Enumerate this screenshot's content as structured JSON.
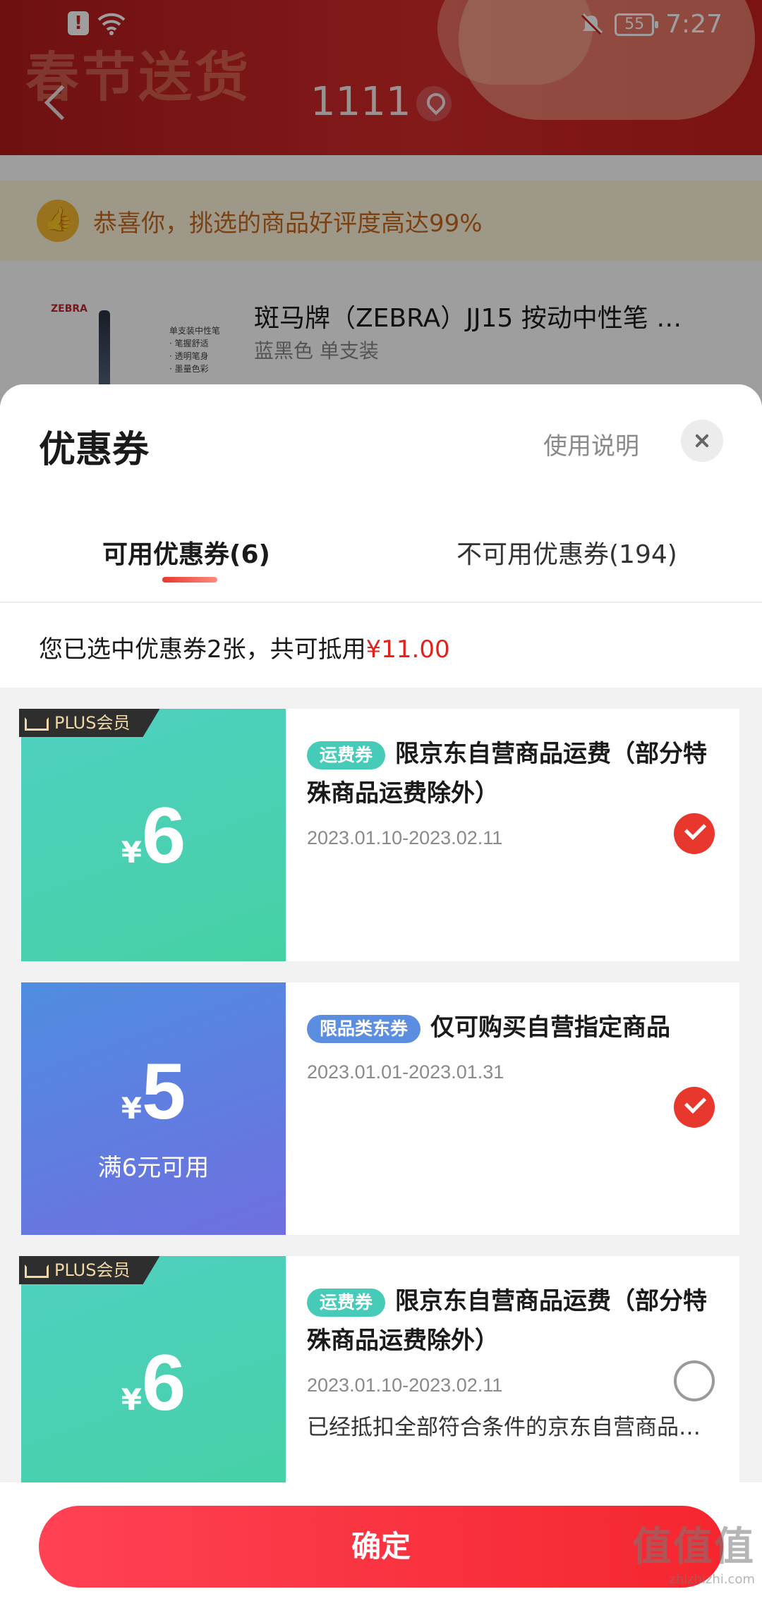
{
  "status_bar": {
    "battery": "55",
    "time": "7:27"
  },
  "background": {
    "festival_text": "春节送货",
    "address": "1111",
    "praise_text": "恭喜你，挑选的商品好评度高达99%",
    "product": {
      "brand": "ZEBRA",
      "image_caption": "单支装中性笔\n· 笔握舒适\n· 透明笔身\n· 墨量色彩",
      "title": "斑马牌（ZEBRA）JJ15 按动中性笔 …",
      "spec": "蓝黑色 单支装"
    }
  },
  "sheet": {
    "title": "优惠券",
    "help_label": "使用说明",
    "tabs": [
      {
        "label": "可用优惠券(6)",
        "active": true
      },
      {
        "label": "不可用优惠券(194)",
        "active": false
      }
    ],
    "summary_prefix": "您已选中优惠券2张，共可抵用",
    "summary_amount": "¥11.00"
  },
  "coupons": [
    {
      "badge": "PLUS会员",
      "currency": "¥",
      "value": "6",
      "condition": "",
      "tag": "运费券",
      "title": "限京东自营商品运费（部分特殊商品运费除外）",
      "date": "2023.01.10-2023.02.11",
      "note": "",
      "selected": true,
      "color": "green"
    },
    {
      "badge": "",
      "currency": "¥",
      "value": "5",
      "condition": "满6元可用",
      "tag": "限品类东券",
      "title": "仅可购买自营指定商品",
      "date": "2023.01.01-2023.01.31",
      "note": "",
      "selected": true,
      "color": "blue"
    },
    {
      "badge": "PLUS会员",
      "currency": "¥",
      "value": "6",
      "condition": "",
      "tag": "运费券",
      "title": "限京东自营商品运费（部分特殊商品运费除外）",
      "date": "2023.01.10-2023.02.11",
      "note": "已经抵扣全部符合条件的京东自营商品…",
      "selected": false,
      "color": "green"
    }
  ],
  "confirm_label": "确定",
  "watermark": {
    "main": "值值值",
    "sub": "zhizhizhi.com"
  },
  "colors": {
    "accent_red": "#e8382e",
    "price_red": "#e2231a",
    "freight_green": "#45cbb8",
    "category_blue": "#5b8de0"
  }
}
